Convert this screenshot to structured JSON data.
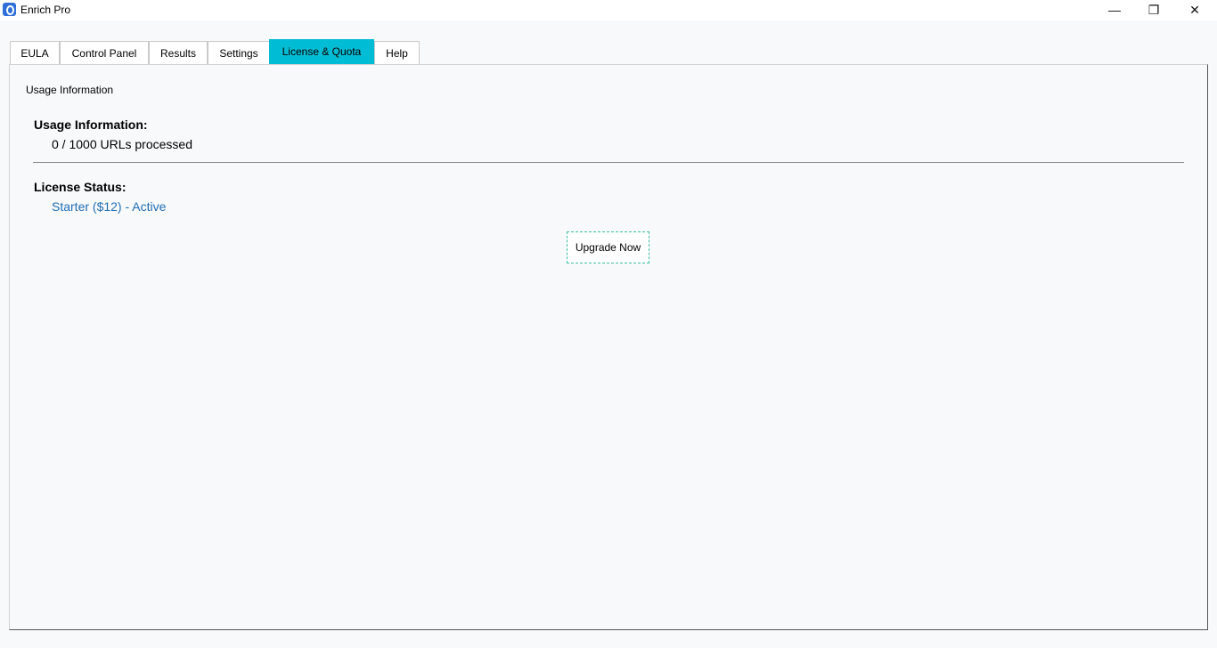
{
  "window": {
    "title": "Enrich Pro",
    "icon": "app-logo-icon",
    "controls": {
      "minimize": "—",
      "maximize": "❐",
      "close": "✕"
    }
  },
  "tabs": [
    {
      "label": "EULA",
      "active": false
    },
    {
      "label": "Control Panel",
      "active": false
    },
    {
      "label": "Results",
      "active": false
    },
    {
      "label": "Settings",
      "active": false
    },
    {
      "label": "License & Quota",
      "active": true
    },
    {
      "label": "Help",
      "active": false
    }
  ],
  "panel": {
    "caption": "Usage Information",
    "usage": {
      "heading": "Usage Information:",
      "text": "0 / 1000 URLs processed"
    },
    "license": {
      "heading": "License Status:",
      "text": "Starter ($12) - Active"
    },
    "upgrade_button": "Upgrade Now"
  },
  "colors": {
    "active_tab": "#00bcd4",
    "license_text": "#1f6fb5",
    "background": "#f8f9fb"
  }
}
